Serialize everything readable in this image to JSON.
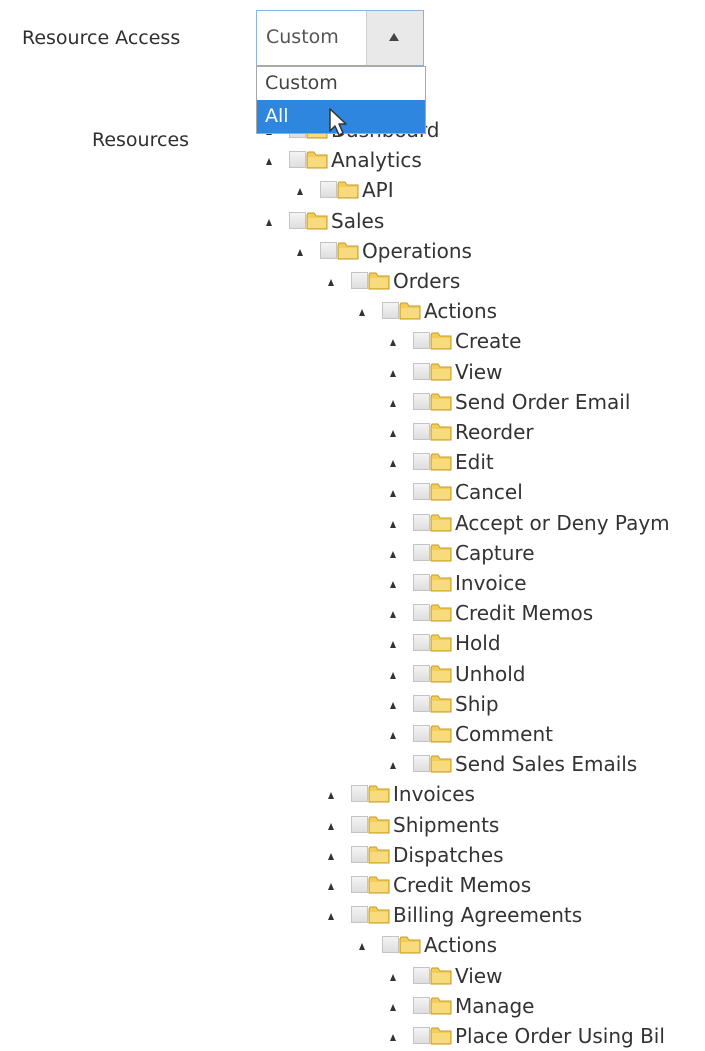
{
  "form": {
    "resource_access_label": "Resource Access",
    "resources_label": "Resources"
  },
  "select": {
    "value": "Custom",
    "options": [
      "Custom",
      "All"
    ],
    "highlighted": "All"
  },
  "tree": [
    {
      "label": "Dashboard",
      "level": 0
    },
    {
      "label": "Analytics",
      "level": 0
    },
    {
      "label": "API",
      "level": 1
    },
    {
      "label": "Sales",
      "level": 0
    },
    {
      "label": "Operations",
      "level": 1
    },
    {
      "label": "Orders",
      "level": 2
    },
    {
      "label": "Actions",
      "level": 3
    },
    {
      "label": "Create",
      "level": 4
    },
    {
      "label": "View",
      "level": 4
    },
    {
      "label": "Send Order Email",
      "level": 4
    },
    {
      "label": "Reorder",
      "level": 4
    },
    {
      "label": "Edit",
      "level": 4
    },
    {
      "label": "Cancel",
      "level": 4
    },
    {
      "label": "Accept or Deny Paym",
      "level": 4
    },
    {
      "label": "Capture",
      "level": 4
    },
    {
      "label": "Invoice",
      "level": 4
    },
    {
      "label": "Credit Memos",
      "level": 4
    },
    {
      "label": "Hold",
      "level": 4
    },
    {
      "label": "Unhold",
      "level": 4
    },
    {
      "label": "Ship",
      "level": 4
    },
    {
      "label": "Comment",
      "level": 4
    },
    {
      "label": "Send Sales Emails",
      "level": 4
    },
    {
      "label": "Invoices",
      "level": 2
    },
    {
      "label": "Shipments",
      "level": 2
    },
    {
      "label": "Dispatches",
      "level": 2
    },
    {
      "label": "Credit Memos",
      "level": 2
    },
    {
      "label": "Billing Agreements",
      "level": 2
    },
    {
      "label": "Actions",
      "level": 3
    },
    {
      "label": "View",
      "level": 4
    },
    {
      "label": "Manage",
      "level": 4
    },
    {
      "label": "Place Order Using Bil",
      "level": 4
    }
  ],
  "icons": {
    "expand": "collapse-triangle-icon",
    "checkbox": "checkbox",
    "folder": "folder-icon",
    "cursor": "mouse-pointer-icon"
  },
  "colors": {
    "highlight": "#2e86de",
    "select_border": "#8cb3d9",
    "folder": "#f2cd5a"
  }
}
